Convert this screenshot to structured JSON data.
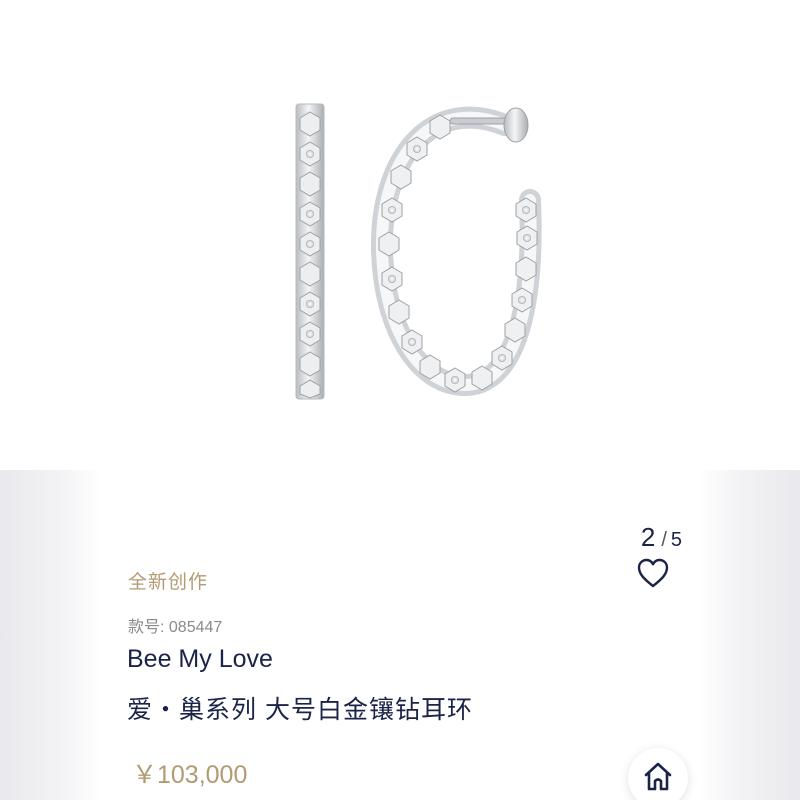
{
  "gallery": {
    "current_index": "2",
    "separator": "/",
    "total": "5",
    "image_subject": "earring-hoop-icon"
  },
  "product": {
    "tag": "全新创作",
    "sku_label": "款号: 085447",
    "collection": "Bee My Love",
    "title": "爱・巢系列 大号白金镶钻耳环",
    "price": "￥103,000"
  },
  "icons": {
    "favorite": "heart-icon",
    "home": "home-icon"
  },
  "colors": {
    "navy": "#1b2348",
    "gold": "#b29a72",
    "gray": "#8a8a8e"
  }
}
